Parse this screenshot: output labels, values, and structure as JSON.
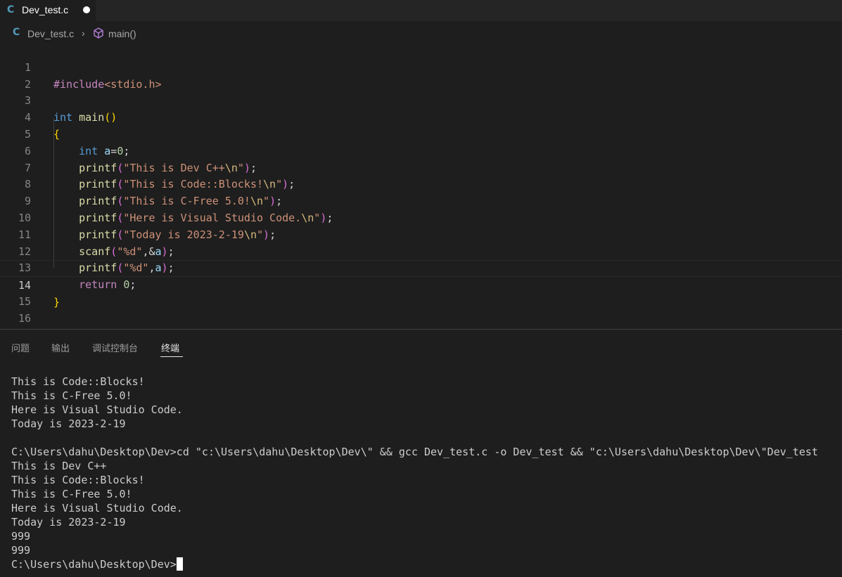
{
  "tab": {
    "file_icon": "C",
    "file_name": "Dev_test.c",
    "unsaved": true
  },
  "breadcrumb": {
    "file_icon": "C",
    "file": "Dev_test.c",
    "chevron": "›",
    "symbol_icon": "cube-icon",
    "symbol": "main()"
  },
  "editor": {
    "current_line": 14,
    "line_numbers": [
      "1",
      "2",
      "3",
      "4",
      "5",
      "6",
      "7",
      "8",
      "9",
      "10",
      "11",
      "12",
      "13",
      "14",
      "15",
      "16"
    ]
  },
  "panel": {
    "tabs": [
      "问题",
      "输出",
      "调试控制台",
      "终端"
    ],
    "active_tab": "终端"
  },
  "terminal": {
    "lines": [
      "This is Code::Blocks!",
      "This is C-Free 5.0!",
      "Here is Visual Studio Code.",
      "Today is 2023-2-19",
      "",
      "C:\\Users\\dahu\\Desktop\\Dev>cd \"c:\\Users\\dahu\\Desktop\\Dev\\\" && gcc Dev_test.c -o Dev_test && \"c:\\Users\\dahu\\Desktop\\Dev\\\"Dev_test",
      "This is Dev C++",
      "This is Code::Blocks!",
      "This is C-Free 5.0!",
      "Here is Visual Studio Code.",
      "Today is 2023-2-19",
      "999",
      "999"
    ],
    "prompt": "C:\\Users\\dahu\\Desktop\\Dev>"
  },
  "colors": {
    "background": "#1e1e1e",
    "keyword": "#569cd6",
    "function": "#dcdcaa",
    "string": "#ce9178",
    "number": "#b5cea8",
    "variable": "#9cdcfe",
    "preprocessor": "#c586c0"
  }
}
